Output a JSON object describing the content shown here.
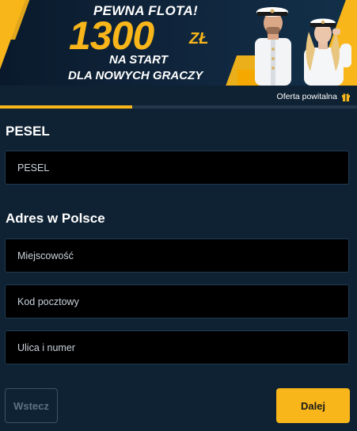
{
  "banner": {
    "line1": "PEWNA FLOTA!",
    "amount": "1300",
    "currency": "ZŁ",
    "line3": "NA START",
    "line4": "DLA NOWYCH GRACZY"
  },
  "progress": {
    "value_percent": 37
  },
  "offer": {
    "label": "Oferta powitalna",
    "icon": "gift-icon"
  },
  "sections": {
    "pesel": {
      "title": "PESEL",
      "field": {
        "placeholder": "PESEL",
        "value": ""
      }
    },
    "address": {
      "title": "Adres w Polsce",
      "fields": [
        {
          "placeholder": "Miejscowość",
          "value": ""
        },
        {
          "placeholder": "Kod pocztowy",
          "value": ""
        },
        {
          "placeholder": "Ulica i numer",
          "value": ""
        }
      ]
    }
  },
  "buttons": {
    "back": "Wstecz",
    "next": "Dalej"
  },
  "colors": {
    "accent": "#f8b61a",
    "background": "#0f2233",
    "field_bg": "#000000",
    "progress_track": "#23384b"
  }
}
